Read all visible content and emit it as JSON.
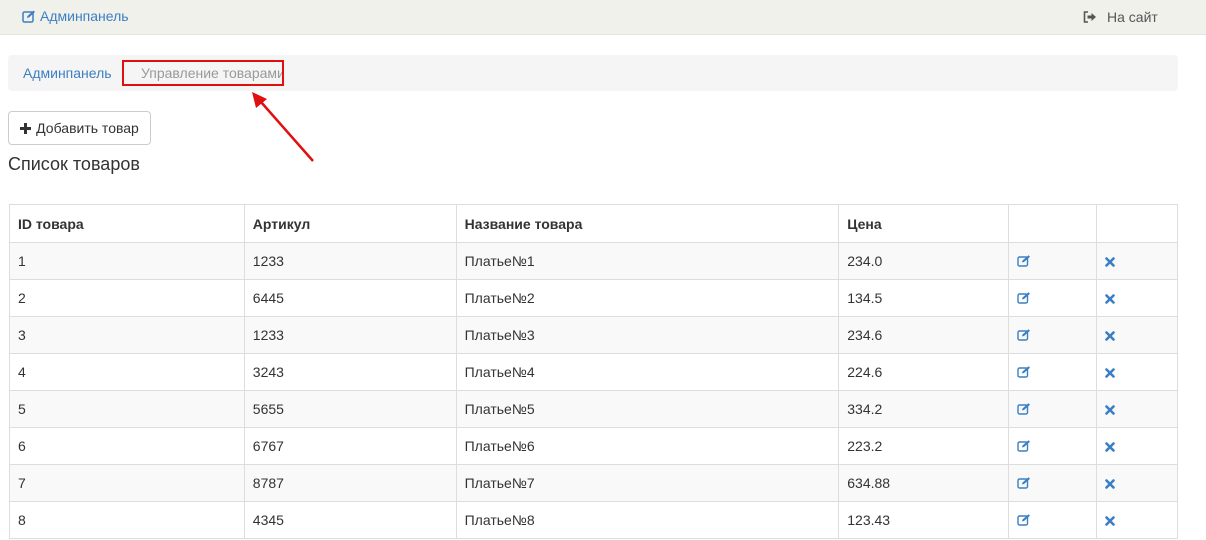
{
  "navbar": {
    "brand_label": "Админпанель",
    "site_link_label": "На сайт"
  },
  "breadcrumb": {
    "home": "Админпанель",
    "current": "Управление товарами"
  },
  "toolbar": {
    "add_label": "Добавить товар"
  },
  "page": {
    "heading": "Список товаров"
  },
  "table": {
    "headers": [
      "ID товара",
      "Артикул",
      "Название товара",
      "Цена",
      "",
      ""
    ],
    "rows": [
      {
        "id": "1",
        "sku": "1233",
        "name": "Платье№1",
        "price": "234.0"
      },
      {
        "id": "2",
        "sku": "6445",
        "name": "Платье№2",
        "price": "134.5"
      },
      {
        "id": "3",
        "sku": "1233",
        "name": "Платье№3",
        "price": "234.6"
      },
      {
        "id": "4",
        "sku": "3243",
        "name": "Платье№4",
        "price": "224.6"
      },
      {
        "id": "5",
        "sku": "5655",
        "name": "Платье№5",
        "price": "334.2"
      },
      {
        "id": "6",
        "sku": "6767",
        "name": "Платье№6",
        "price": "223.2"
      },
      {
        "id": "7",
        "sku": "8787",
        "name": "Платье№7",
        "price": "634.88"
      },
      {
        "id": "8",
        "sku": "4345",
        "name": "Платье№8",
        "price": "123.43"
      }
    ]
  },
  "icons": {
    "brand": "edit-icon",
    "site_link": "sign-out-icon",
    "add": "plus-icon",
    "row_edit": "edit-icon",
    "row_delete": "remove-icon"
  },
  "colors": {
    "link": "#3b7fc2",
    "annotation": "#e01010",
    "navbar_bg": "#f1f1ec",
    "breadcrumb_bg": "#f5f5f5"
  }
}
